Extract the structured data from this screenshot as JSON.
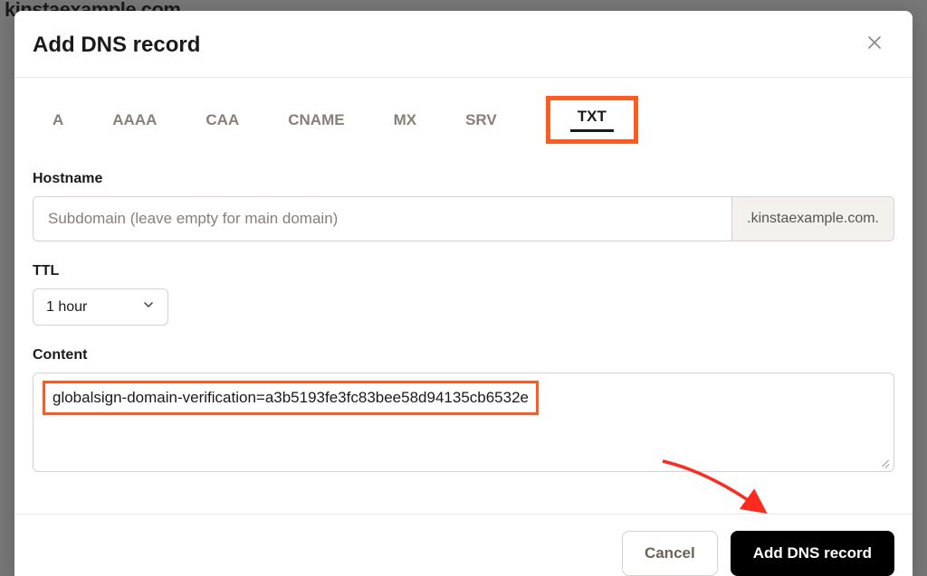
{
  "background": {
    "page_title_fragment": "kinstaexample.com"
  },
  "modal": {
    "title": "Add DNS record",
    "tabs": [
      "A",
      "AAAA",
      "CAA",
      "CNAME",
      "MX",
      "SRV",
      "TXT"
    ],
    "active_tab": "TXT",
    "hostname": {
      "label": "Hostname",
      "placeholder": "Subdomain (leave empty for main domain)",
      "suffix": ".kinstaexample.com.",
      "value": ""
    },
    "ttl": {
      "label": "TTL",
      "value": "1 hour"
    },
    "content": {
      "label": "Content",
      "value": "globalsign-domain-verification=a3b5193fe3fc83bee58d94135cb6532e"
    },
    "footer": {
      "cancel": "Cancel",
      "submit": "Add DNS record"
    }
  },
  "annotation": {
    "highlight_color": "#ff5a1f"
  }
}
